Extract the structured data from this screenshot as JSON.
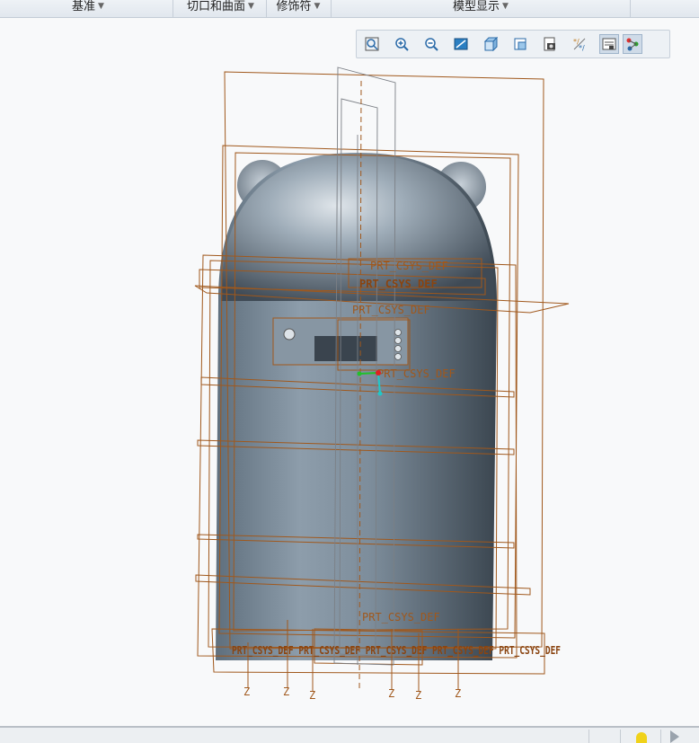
{
  "ribbon": {
    "groups": [
      {
        "label": "基准"
      },
      {
        "label": "切口和曲面"
      },
      {
        "label": "修饰符"
      },
      {
        "label": "模型显示"
      }
    ]
  },
  "view_toolbar": {
    "buttons": [
      {
        "icon": "refit-icon"
      },
      {
        "icon": "zoom-in-icon"
      },
      {
        "icon": "zoom-out-icon"
      },
      {
        "icon": "repaint-icon"
      },
      {
        "icon": "display-style-icon"
      },
      {
        "icon": "saved-orientations-icon"
      },
      {
        "icon": "view-manager-icon"
      },
      {
        "icon": "perspective-view-icon"
      },
      {
        "icon": "datum-display-filters-icon",
        "active": true
      },
      {
        "icon": "spin-center-icon",
        "active": true
      }
    ]
  },
  "model": {
    "csys_labels": [
      "PRT_CSYS_DEF",
      "PRT_CSYS_DEF",
      "PRT_CSYS_DEF",
      "PRT_CSYS_DEF",
      "PRT_CSYS_DEF"
    ],
    "bottom_label_overlap": "PRT_CSYS_DEF PRT_CSYS_DEF PRT_CSYS_DEF PRT_CSYS_DEF PRT_CSYS_DEF",
    "axis_z_label": "Z",
    "colors": {
      "body": "#6e7f8e",
      "datum": "#a0581c",
      "background": "#f8f9fa"
    }
  }
}
